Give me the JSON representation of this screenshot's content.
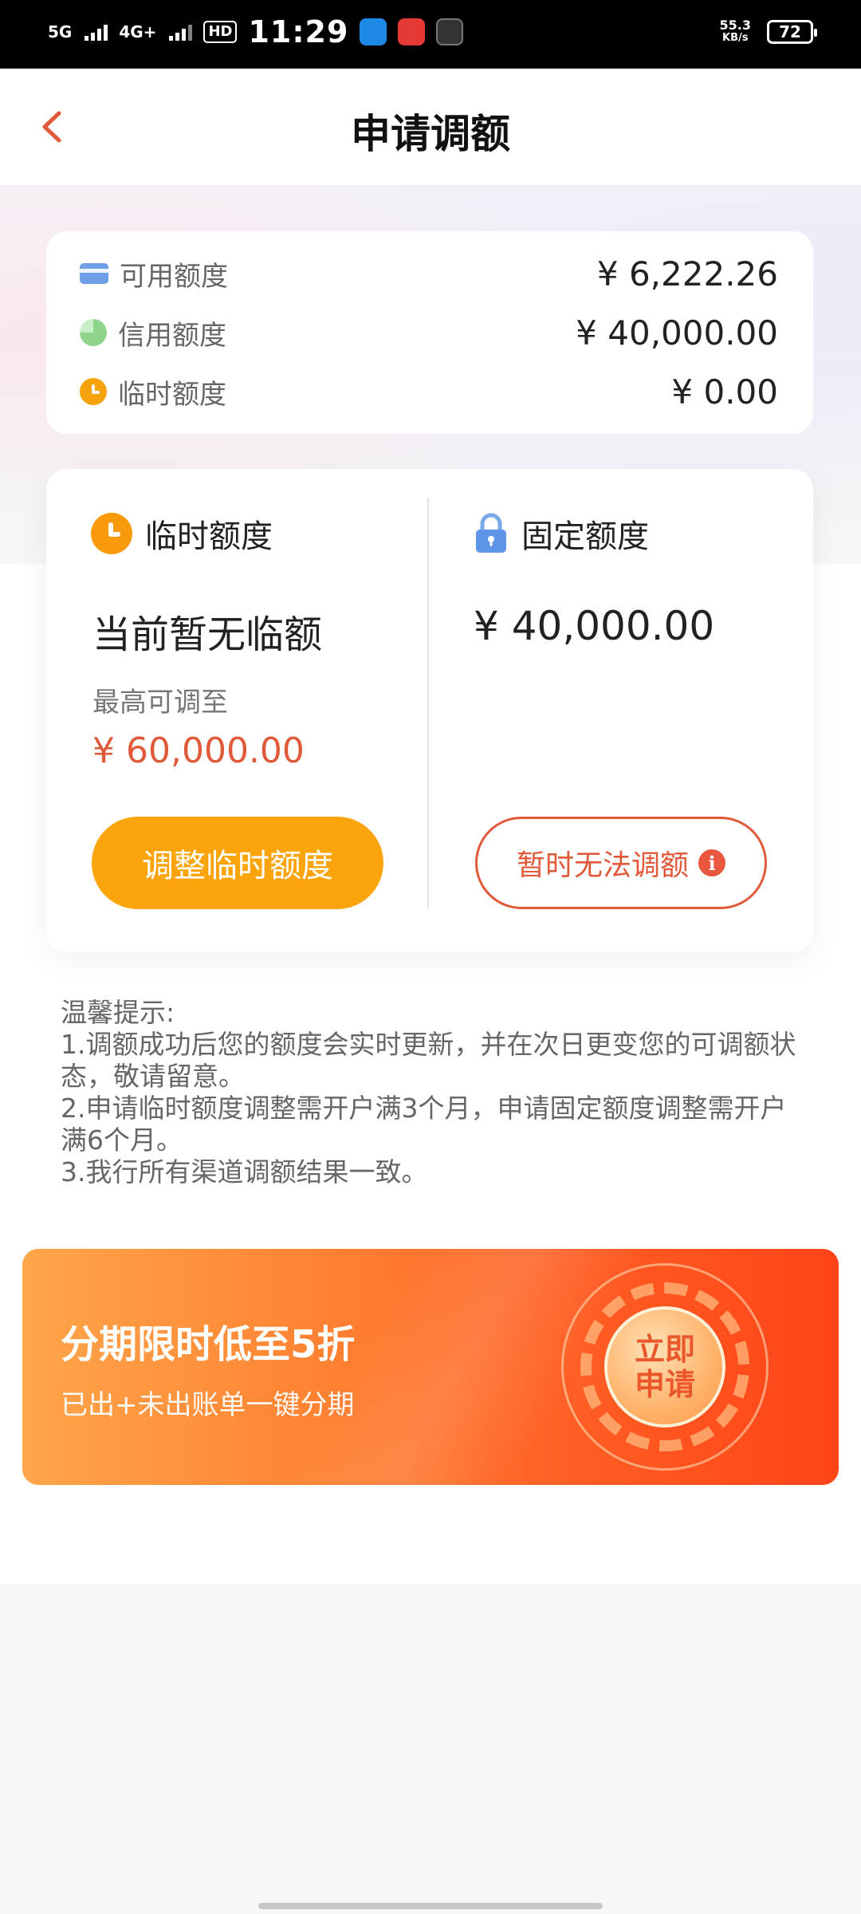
{
  "status_bar": {
    "signal1": "5G",
    "signal2": "4G+",
    "hd": "HD",
    "time": "11:29",
    "net_speed": "55.3",
    "net_unit": "KB/s",
    "battery": "72"
  },
  "header": {
    "title": "申请调额"
  },
  "summary": {
    "items": [
      {
        "label": "可用额度",
        "value": "¥ 6,222.26",
        "icon": "card-icon"
      },
      {
        "label": "信用额度",
        "value": "¥ 40,000.00",
        "icon": "pie-icon"
      },
      {
        "label": "临时额度",
        "value": "¥ 0.00",
        "icon": "clock-icon"
      }
    ]
  },
  "temporary": {
    "title": "临时额度",
    "status": "当前暂无临额",
    "max_label": "最高可调至",
    "max_value": "¥ 60,000.00",
    "button": "调整临时额度"
  },
  "fixed": {
    "title": "固定额度",
    "value": "¥ 40,000.00",
    "button": "暂时无法调额",
    "info_glyph": "i"
  },
  "tips": {
    "heading": "温馨提示:",
    "lines": [
      "1.调额成功后您的额度会实时更新，并在次日更变您的可调额状态，敬请留意。",
      "2.申请临时额度调整需开户满3个月，申请固定额度调整需开户满6个月。",
      "3.我行所有渠道调额结果一致。"
    ]
  },
  "banner": {
    "title": "分期限时低至5折",
    "subtitle": "已出+未出账单一键分期",
    "cta_line1": "立即",
    "cta_line2": "申请"
  },
  "colors": {
    "accent_red": "#e05a3a",
    "accent_orange": "#fba40b",
    "banner_orange": "#ff5c23"
  }
}
